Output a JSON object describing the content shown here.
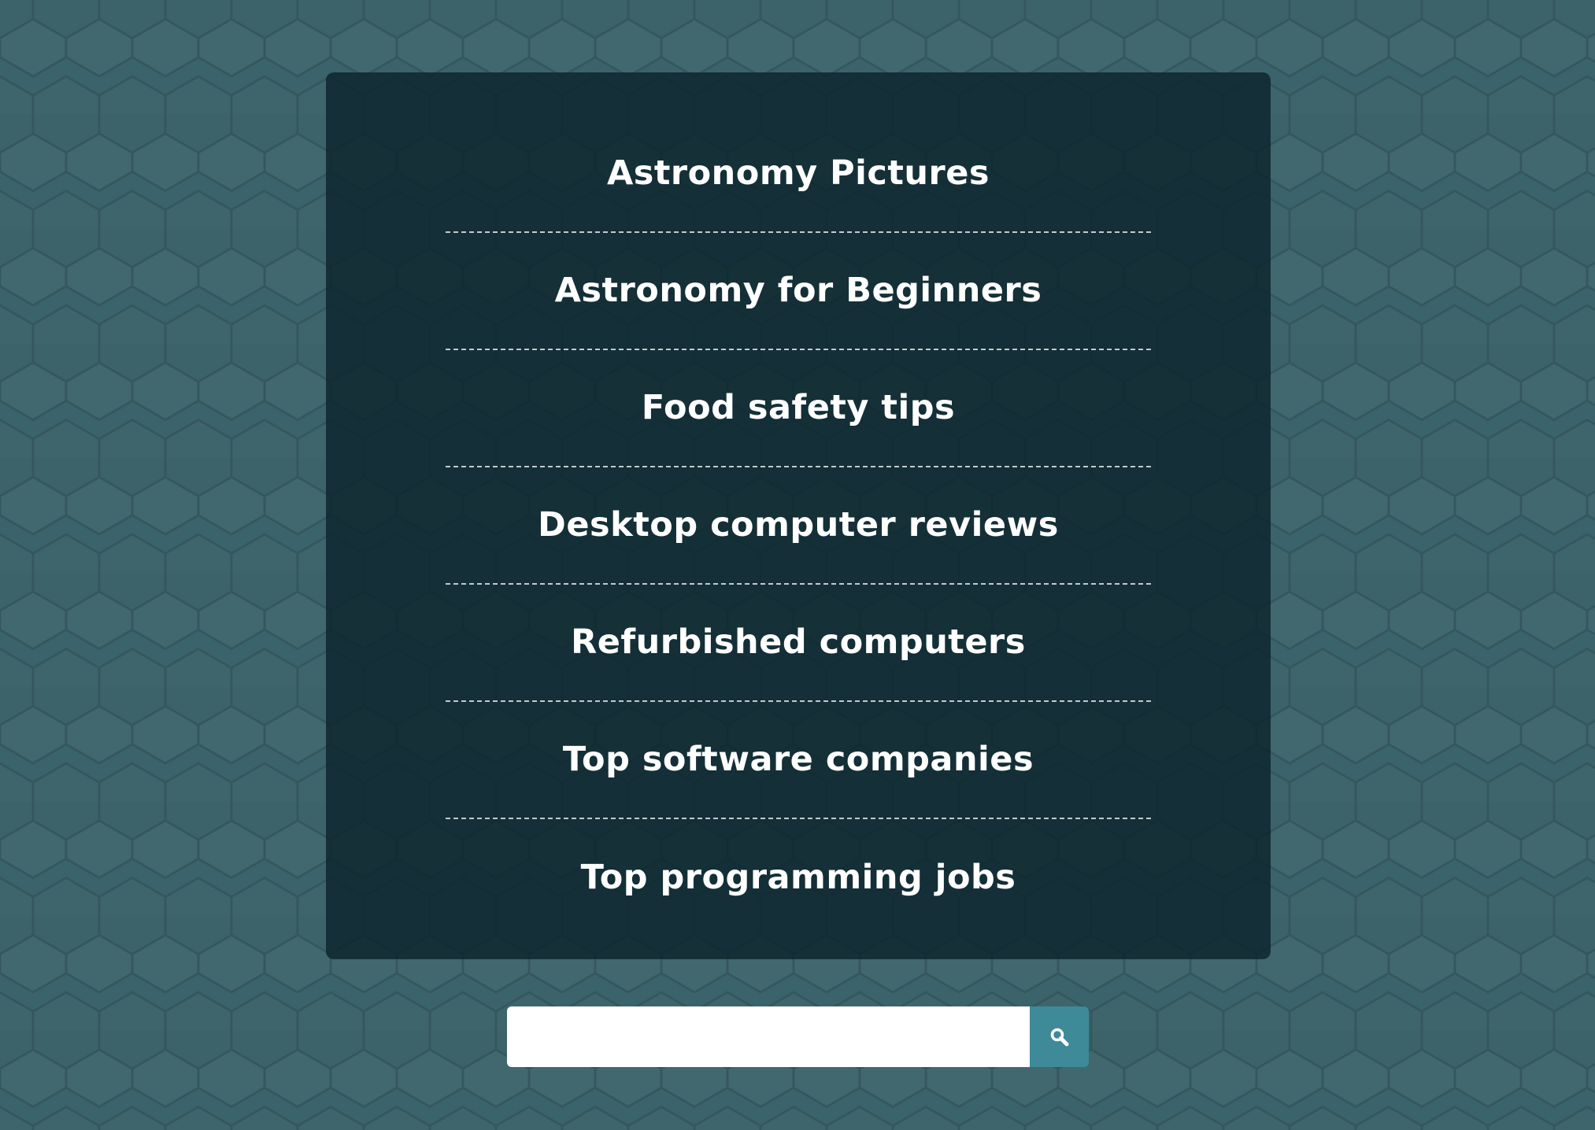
{
  "links": [
    {
      "label": "Astronomy Pictures"
    },
    {
      "label": "Astronomy for Beginners"
    },
    {
      "label": "Food safety tips"
    },
    {
      "label": "Desktop computer reviews"
    },
    {
      "label": "Refurbished computers"
    },
    {
      "label": "Top software companies"
    },
    {
      "label": "Top programming jobs"
    }
  ],
  "search": {
    "value": "",
    "placeholder": "",
    "button_icon": "search-icon"
  },
  "colors": {
    "background": "#3b636b",
    "panel": "#163139",
    "text": "#ffffff",
    "search_button": "#3e8a98"
  }
}
